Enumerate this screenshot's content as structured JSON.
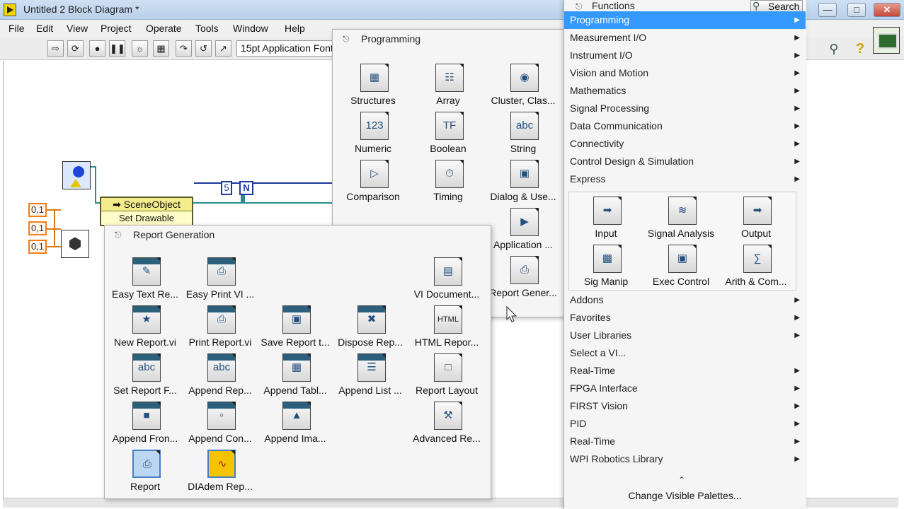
{
  "window": {
    "title": "Untitled 2 Block Diagram *",
    "min": "—",
    "max": "□",
    "close": "✕"
  },
  "menu": [
    "File",
    "Edit",
    "View",
    "Project",
    "Operate",
    "Tools",
    "Window",
    "Help"
  ],
  "toolbar": {
    "font": "15pt Application Font"
  },
  "diagram": {
    "scene_object": "➡ SceneObject",
    "set_drawable": "Set Drawable",
    "constants": [
      "0,1",
      "0,1",
      "0,1"
    ],
    "numeric_const": "5",
    "n_terminal": "N"
  },
  "programming_palette": {
    "title": "Programming",
    "items": [
      "Structures",
      "Array",
      "Cluster, Clas...",
      "Numeric",
      "Boolean",
      "String",
      "Comparison",
      "Timing",
      "Dialog & Use...",
      "Application ...",
      "Report Gener..."
    ]
  },
  "report_palette": {
    "title": "Report Generation",
    "items": [
      "Easy Text Re...",
      "Easy Print VI ...",
      "VI Document...",
      "New Report.vi",
      "Print Report.vi",
      "Save Report t...",
      "Dispose Rep...",
      "HTML Repor...",
      "Set Report F...",
      "Append Rep...",
      "Append Tabl...",
      "Append List ...",
      "Report Layout",
      "Append Fron...",
      "Append Con...",
      "Append Ima...",
      "Advanced Re...",
      "Report",
      "DIAdem Rep..."
    ],
    "html_icon": "HTML"
  },
  "functions_palette": {
    "title": "Functions",
    "search": "Search",
    "categories_top": [
      "Programming",
      "Measurement I/O",
      "Instrument I/O",
      "Vision and Motion",
      "Mathematics",
      "Signal Processing",
      "Data Communication",
      "Connectivity",
      "Control Design & Simulation",
      "Express"
    ],
    "express_items": [
      "Input",
      "Signal Analysis",
      "Output",
      "Sig Manip",
      "Exec Control",
      "Arith & Com..."
    ],
    "categories_bottom": [
      "Addons",
      "Favorites",
      "User Libraries",
      "Select a VI...",
      "Real-Time",
      "FPGA Interface",
      "FIRST Vision",
      "PID",
      "Real-Time",
      "WPI Robotics Library"
    ],
    "change_visible": "Change Visible Palettes...",
    "selected": "Programming"
  }
}
